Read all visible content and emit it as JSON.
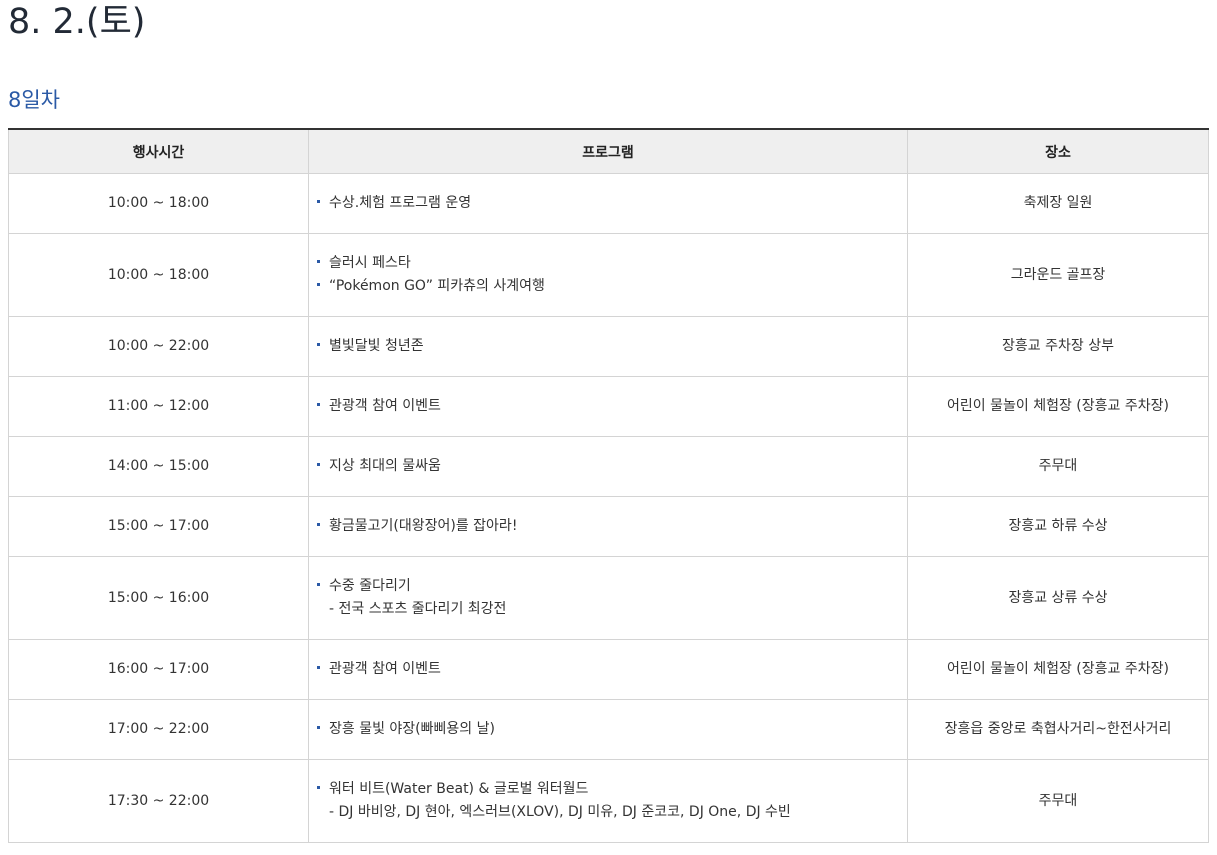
{
  "page": {
    "title": "8. 2.(토)",
    "day_label": "8일차"
  },
  "table": {
    "headers": [
      "행사시간",
      "프로그램",
      "장소"
    ],
    "rows": [
      {
        "time": "10:00 ~ 18:00",
        "programs": [
          "수상.체험 프로그램 운영"
        ],
        "place": "축제장 일원"
      },
      {
        "time": "10:00 ~ 18:00",
        "programs": [
          "슬러시 페스타",
          "“Pokémon GO” 피카츄의 사계여행"
        ],
        "place": "그라운드 골프장"
      },
      {
        "time": "10:00 ~ 22:00",
        "programs": [
          "별빛달빛 청년존"
        ],
        "place": "장흥교 주차장 상부"
      },
      {
        "time": "11:00 ~ 12:00",
        "programs": [
          "관광객 참여 이벤트"
        ],
        "place": "어린이 물놀이 체험장 (장흥교 주차장)"
      },
      {
        "time": "14:00 ~ 15:00",
        "programs": [
          "지상 최대의 물싸움"
        ],
        "place": "주무대"
      },
      {
        "time": "15:00 ~ 17:00",
        "programs": [
          "황금물고기(대왕장어)를 잡아라!"
        ],
        "place": "장흥교 하류 수상"
      },
      {
        "time": "15:00 ~ 16:00",
        "programs": [
          "수중 줄다리기"
        ],
        "sub": "- 전국 스포츠 줄다리기 최강전",
        "place": "장흥교 상류 수상"
      },
      {
        "time": "16:00 ~ 17:00",
        "programs": [
          "관광객 참여 이벤트"
        ],
        "place": "어린이 물놀이 체험장 (장흥교 주차장)"
      },
      {
        "time": "17:00 ~ 22:00",
        "programs": [
          "장흥 물빛 야장(빠삐용의 날)"
        ],
        "place": "장흥읍 중앙로 축협사거리~한전사거리"
      },
      {
        "time": "17:30 ~ 22:00",
        "programs": [
          "워터 비트(Water Beat) & 글로벌 워터월드"
        ],
        "sub": "- DJ 바비앙, DJ 현아, 엑스러브(XLOV), DJ 미유, DJ 준코코, DJ One, DJ 수빈",
        "place": "주무대"
      }
    ]
  }
}
